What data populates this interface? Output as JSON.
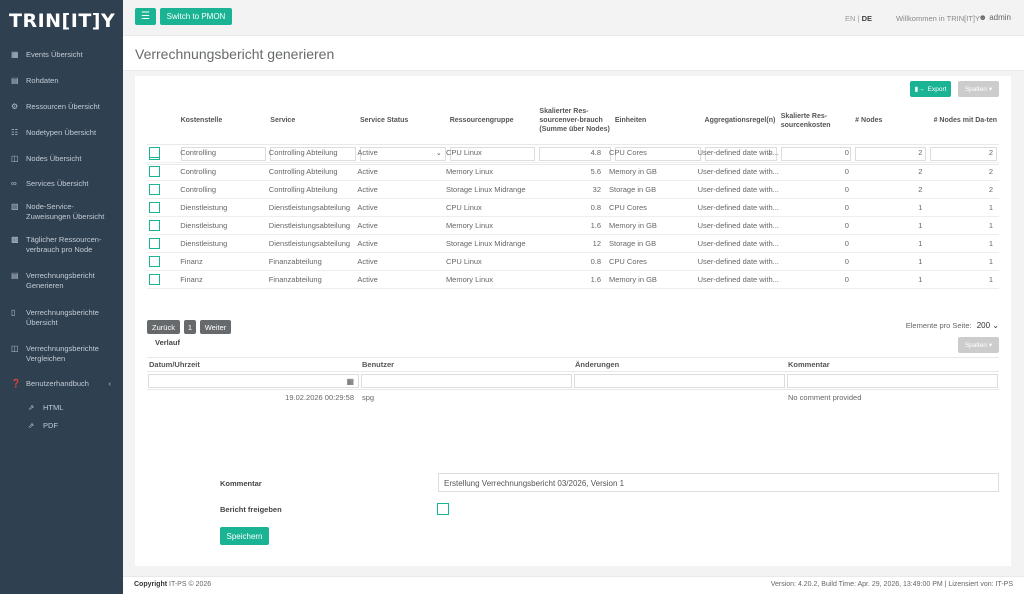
{
  "app": {
    "logo_text": "TRIN[IT]Y",
    "switch_button": "Switch to PMON",
    "menu_icon": "hamburger-icon",
    "lang_en": "EN",
    "lang_sep": "|",
    "lang_de": "DE",
    "welcome": "Willkommen in TRIN[IT]Y",
    "user": "admin"
  },
  "sidebar": {
    "items": [
      {
        "label": "Events Übersicht",
        "icon": "calendar-icon"
      },
      {
        "label": "Rohdaten",
        "icon": "list-icon"
      },
      {
        "label": "Ressourcen Übersicht",
        "icon": "gear-icon"
      },
      {
        "label": "Nodetypen Übersicht",
        "icon": "nodes-icon"
      },
      {
        "label": "Nodes Übersicht",
        "icon": "server-icon"
      },
      {
        "label": "Services Übersicht",
        "icon": "link-icon"
      },
      {
        "label": "Node-Service-Zuweisungen Übersicht",
        "icon": "sitemap-icon"
      },
      {
        "label": "Täglicher Ressourcen-verbrauch pro Node",
        "icon": "bar-chart-icon"
      },
      {
        "label": "Verrechnungsbericht Generieren",
        "icon": "report-icon"
      },
      {
        "label": "Verrechnungsberichte Übersicht",
        "icon": "file-icon"
      },
      {
        "label": "Verrechnungsberichte Vergleichen",
        "icon": "compare-icon"
      },
      {
        "label": "Benutzerhandbuch",
        "icon": "question-icon"
      }
    ],
    "subitems": [
      {
        "label": "HTML",
        "icon": "external-link-icon"
      },
      {
        "label": "PDF",
        "icon": "external-link-icon"
      }
    ]
  },
  "page": {
    "title": "Verrechnungsbericht generieren",
    "export_label": "Export",
    "columns_label": "Spalten"
  },
  "table": {
    "headers": [
      "Kostenstelle",
      "Service",
      "Service Status",
      "Ressourcengruppe",
      "Skalierter Res-sourcenver-brauch (Summe über Nodes)",
      "Einheiten",
      "Aggregationsregel(n)",
      "Skalierte Res-sourcenkosten",
      "# Nodes",
      "# Nodes mit Da-ten"
    ],
    "rows": [
      [
        "Controlling",
        "Controlling Abteilung",
        "Active",
        "CPU Linux",
        "4.8",
        "CPU Cores",
        "User-defined date with...",
        "0",
        "2",
        "2"
      ],
      [
        "Controlling",
        "Controlling Abteilung",
        "Active",
        "Memory Linux",
        "5.6",
        "Memory in GB",
        "User-defined date with...",
        "0",
        "2",
        "2"
      ],
      [
        "Controlling",
        "Controlling Abteilung",
        "Active",
        "Storage Linux Midrange",
        "32",
        "Storage in GB",
        "User-defined date with...",
        "0",
        "2",
        "2"
      ],
      [
        "Dienstleistung",
        "Dienstleistungsabteilung",
        "Active",
        "CPU Linux",
        "0.8",
        "CPU Cores",
        "User-defined date with...",
        "0",
        "1",
        "1"
      ],
      [
        "Dienstleistung",
        "Dienstleistungsabteilung",
        "Active",
        "Memory Linux",
        "1.6",
        "Memory in GB",
        "User-defined date with...",
        "0",
        "1",
        "1"
      ],
      [
        "Dienstleistung",
        "Dienstleistungsabteilung",
        "Active",
        "Storage Linux Midrange",
        "12",
        "Storage in GB",
        "User-defined date with...",
        "0",
        "1",
        "1"
      ],
      [
        "Finanz",
        "Finanzabteilung",
        "Active",
        "CPU Linux",
        "0.8",
        "CPU Cores",
        "User-defined date with...",
        "0",
        "1",
        "1"
      ],
      [
        "Finanz",
        "Finanzabteilung",
        "Active",
        "Memory Linux",
        "1.6",
        "Memory in GB",
        "User-defined date with...",
        "0",
        "1",
        "1"
      ]
    ]
  },
  "pagination": {
    "prev": "Zurück",
    "page": "1",
    "next": "Weiter",
    "per_page_label": "Elemente pro Seite:",
    "per_page_value": "200"
  },
  "history": {
    "title": "Verlauf",
    "columns_label": "Spalten",
    "headers": [
      "Datum/Uhrzeit",
      "Benutzer",
      "Änderungen",
      "Kommentar"
    ],
    "rows": [
      [
        "19.02.2026 00:29:58",
        "spg",
        "",
        "No comment provided"
      ]
    ]
  },
  "form": {
    "comment_label": "Kommentar",
    "comment_value": "Erstellung Verrechnungsbericht 03/2026, Version 1",
    "release_label": "Bericht freigeben",
    "save_label": "Speichern"
  },
  "footer": {
    "copyright_label": "Copyright",
    "copyright_text": "IT-PS © 2026",
    "version": "Version: 4.20.2, Build Time: Apr. 29, 2026, 13:49:00 PM | Lizensiert von: IT-PS"
  },
  "colors": {
    "sidebar": "#2f4050",
    "accent": "#1ab394",
    "background": "#f3f3f4"
  }
}
